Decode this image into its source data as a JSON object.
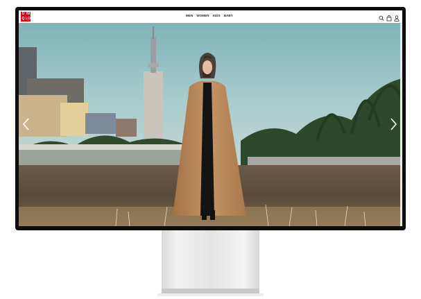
{
  "logo": {
    "lines": [
      "UNI",
      "QLO"
    ]
  },
  "nav": {
    "items": [
      "MEN",
      "WOMEN",
      "KIDS",
      "BABY"
    ]
  },
  "icons": {
    "search": "search-icon",
    "cart": "cart-icon",
    "account": "user-icon",
    "prev": "chevron-left-icon",
    "next": "chevron-right-icon"
  },
  "colors": {
    "brand": "#e60012",
    "bezel": "#0d0d0d",
    "coat": "#b98858",
    "sky": "#8fbcc0"
  }
}
